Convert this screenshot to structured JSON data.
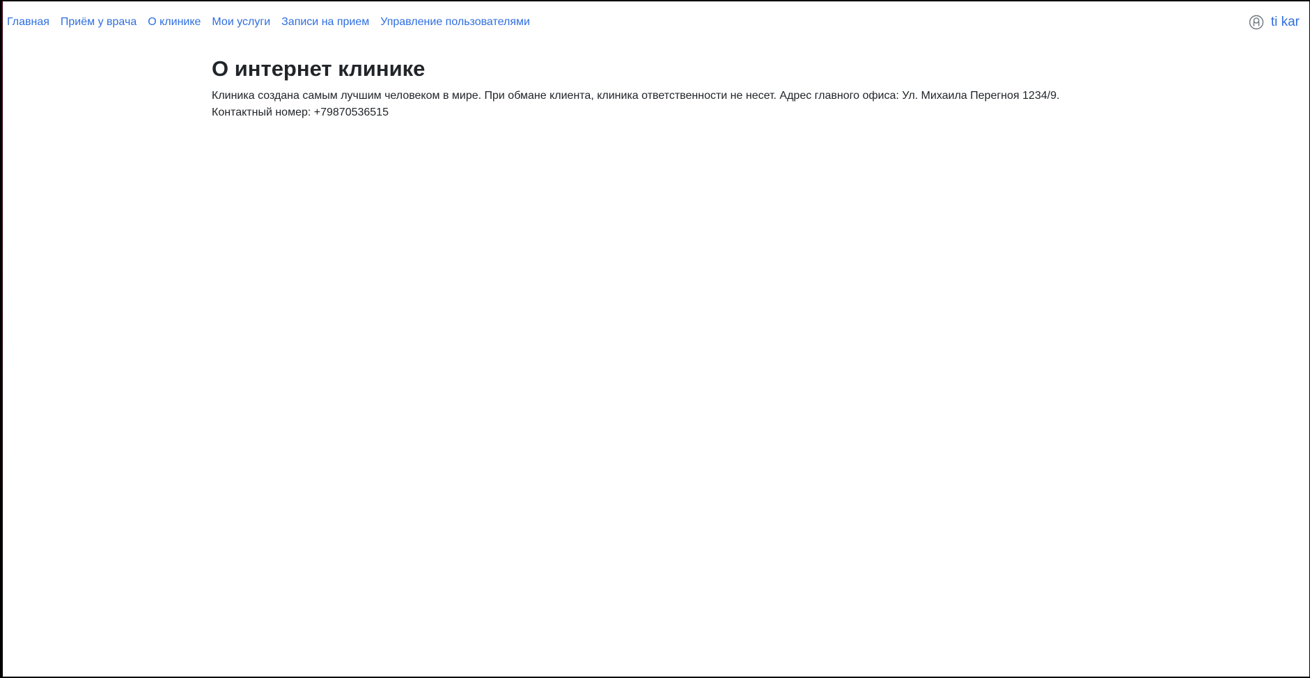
{
  "nav": {
    "links": [
      {
        "label": "Главная"
      },
      {
        "label": "Приём у врача"
      },
      {
        "label": "О клинике"
      },
      {
        "label": "Мои услуги"
      },
      {
        "label": "Записи на прием"
      },
      {
        "label": "Управление пользователями"
      }
    ]
  },
  "user": {
    "name": "ti kar",
    "icon": "user-circle-icon"
  },
  "main": {
    "title": "О интернет клинике",
    "line1": "Клиника создана самым лучшим человеком в мире. При обмане клиента, клиника ответственности не несет. Адрес главного офиса: Ул. Михаила Перегноя 1234/9.",
    "line2": "Контактный номер: +79870536515"
  },
  "colors": {
    "link": "#2f6fe0",
    "text": "#212529",
    "background": "#ffffff"
  }
}
